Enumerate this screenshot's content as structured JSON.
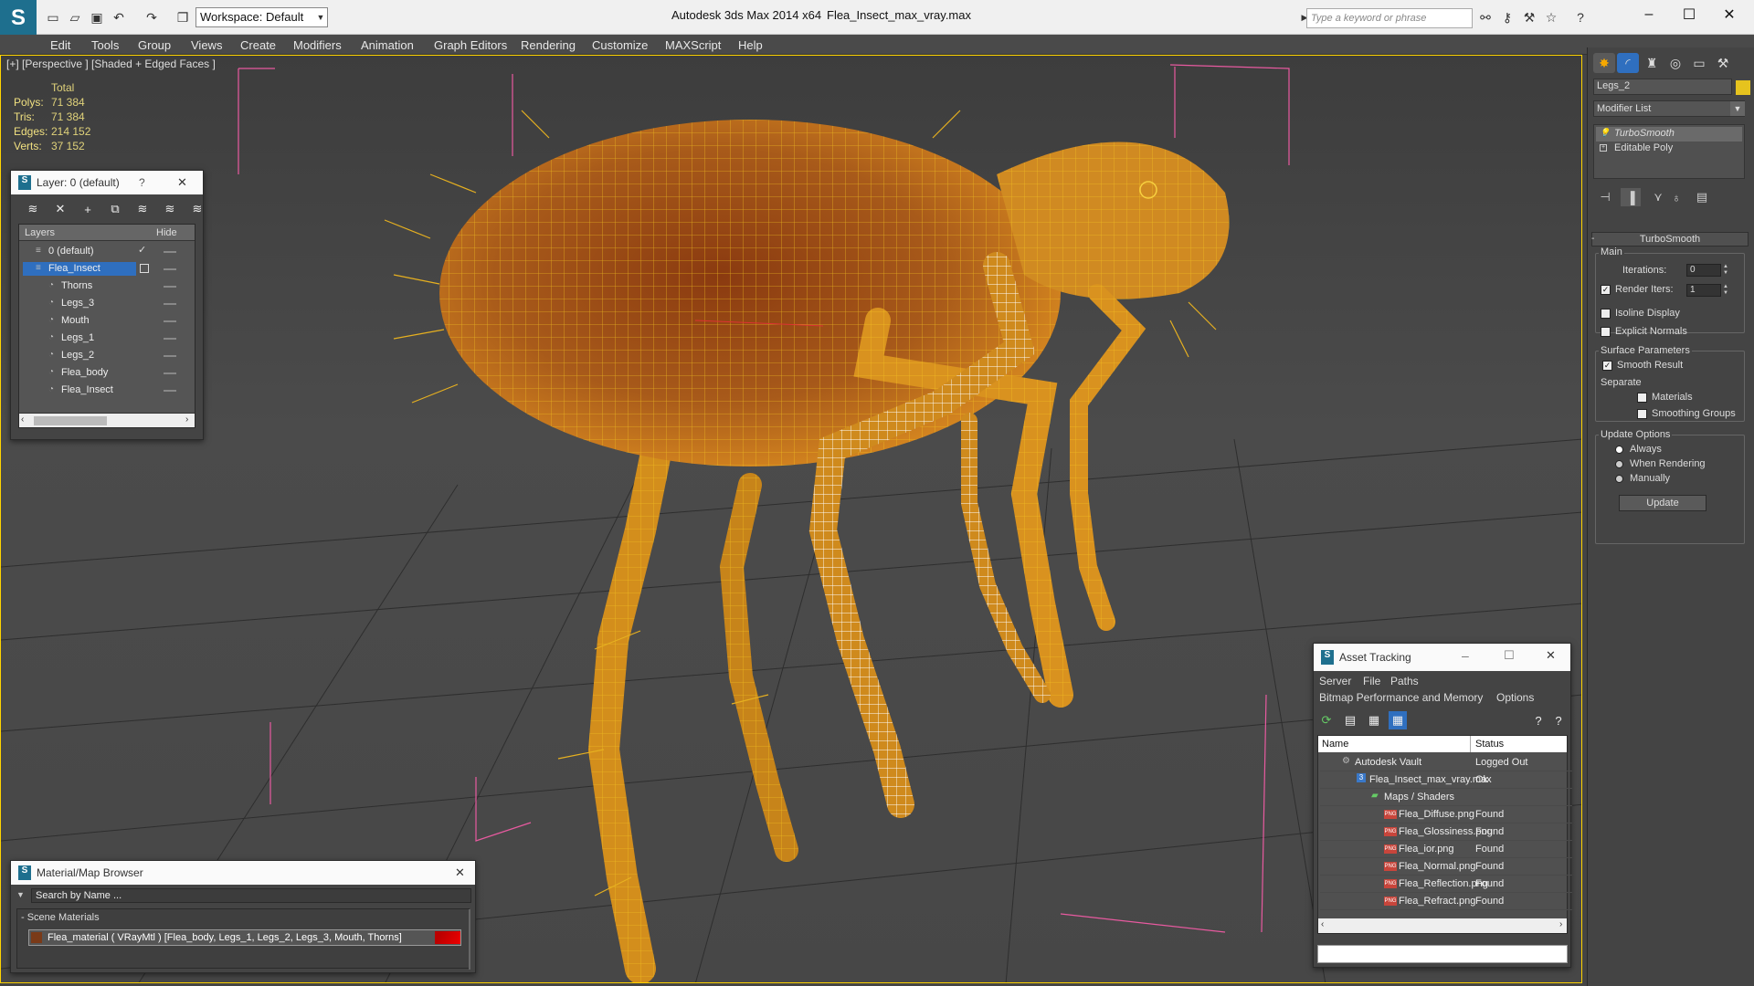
{
  "titlebar": {
    "workspace": "Workspace: Default",
    "app_title": "Autodesk 3ds Max  2014 x64",
    "file_title": "Flea_Insect_max_vray.max",
    "search_placeholder": "Type a keyword or phrase"
  },
  "menu": [
    "Edit",
    "Tools",
    "Group",
    "Views",
    "Create",
    "Modifiers",
    "Animation",
    "Graph Editors",
    "Rendering",
    "Customize",
    "MAXScript",
    "Help"
  ],
  "viewport": {
    "label": "[+] [Perspective ] [Shaded + Edged Faces ]",
    "stats_header": "Total",
    "stats": [
      {
        "key": "Polys:",
        "value": "71 384"
      },
      {
        "key": "Tris:",
        "value": "71 384"
      },
      {
        "key": "Edges:",
        "value": "214 152"
      },
      {
        "key": "Verts:",
        "value": "37 152"
      }
    ]
  },
  "layer_panel": {
    "title": "Layer: 0 (default)",
    "help": "?",
    "col_layers": "Layers",
    "col_hide": "Hide",
    "rows": [
      {
        "label": "0 (default)"
      },
      {
        "label": "Flea_Insect"
      },
      {
        "label": "Thorns"
      },
      {
        "label": "Legs_3"
      },
      {
        "label": "Mouth"
      },
      {
        "label": "Legs_1"
      },
      {
        "label": "Legs_2"
      },
      {
        "label": "Flea_body"
      },
      {
        "label": "Flea_Insect"
      }
    ]
  },
  "material_browser": {
    "title": "Material/Map Browser",
    "search_placeholder": "Search by Name ...",
    "section": "- Scene Materials",
    "material": "Flea_material  ( VRayMtl )  [Flea_body, Legs_1, Legs_2, Legs_3, Mouth, Thorns]"
  },
  "asset_tracking": {
    "title": "Asset Tracking",
    "menu1": [
      "Server",
      "File",
      "Paths"
    ],
    "menu2": [
      "Bitmap Performance and Memory",
      "Options"
    ],
    "col_name": "Name",
    "col_status": "Status",
    "rows": [
      {
        "name": "Autodesk Vault",
        "status": "Logged Out"
      },
      {
        "name": "Flea_Insect_max_vray.max",
        "status": "Ok"
      },
      {
        "name": "Maps / Shaders",
        "status": ""
      },
      {
        "name": "Flea_Diffuse.png",
        "status": "Found"
      },
      {
        "name": "Flea_Glossiness.png",
        "status": "Found"
      },
      {
        "name": "Flea_ior.png",
        "status": "Found"
      },
      {
        "name": "Flea_Normal.png",
        "status": "Found"
      },
      {
        "name": "Flea_Reflection.png",
        "status": "Found"
      },
      {
        "name": "Flea_Refract.png",
        "status": "Found"
      }
    ]
  },
  "command_panel": {
    "object_name": "Legs_2",
    "modifier_list": "Modifier List",
    "stack": [
      "TurboSmooth",
      "Editable Poly"
    ],
    "rollout": "TurboSmooth",
    "main": "Main",
    "iterations_label": "Iterations:",
    "iterations_value": "0",
    "render_iters_label": "Render Iters:",
    "render_iters_value": "1",
    "isoline": "Isoline Display",
    "explicit_normals": "Explicit Normals",
    "surface_params": "Surface Parameters",
    "smooth_result": "Smooth Result",
    "separate": "Separate",
    "materials": "Materials",
    "smoothing_groups": "Smoothing Groups",
    "update_options": "Update Options",
    "always": "Always",
    "when_rendering": "When Rendering",
    "manually": "Manually",
    "update_btn": "Update"
  },
  "colors": {
    "accent": "#1e6f8e",
    "selection": "#2f6fbf",
    "viewport_border": "#ffd400",
    "wire": "#e8b21c"
  }
}
